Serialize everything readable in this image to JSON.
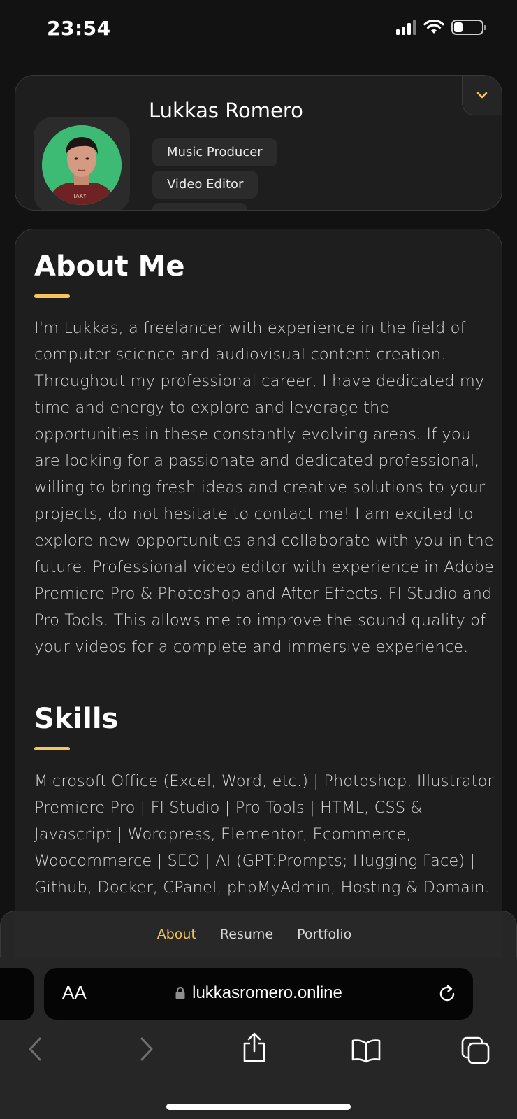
{
  "status_bar": {
    "time": "23:54",
    "battery_level": 0.25
  },
  "profile": {
    "name": "Lukkas Romero",
    "titles": [
      "Music Producer",
      "Video Editor",
      ""
    ]
  },
  "about": {
    "heading": "About Me",
    "text": "I'm Lukkas, a freelancer with experience in the field of computer science and audiovisual content creation. Throughout my professional career, I have dedicated my time and energy to explore and leverage the opportunities in these constantly evolving areas. If you are looking for a passionate and dedicated professional, willing to bring fresh ideas and creative solutions to your projects, do not hesitate to contact me! I am excited to explore new opportunities and collaborate with you in the future. Professional video editor with experience in Adobe Premiere Pro & Photoshop and After Effects. Fl Studio and Pro Tools. This allows me to improve the sound quality of your videos for a complete and immersive experience."
  },
  "skills": {
    "heading": "Skills",
    "text": "Microsoft Office (Excel, Word, etc.) | Photoshop, Illustrator Premiere Pro | Fl Studio | Pro Tools | HTML, CSS & Javascript | Wordpress, Elementor, Ecommerce, Woocommerce | SEO | AI (GPT:Prompts; Hugging Face) | Github, Docker, CPanel, phpMyAdmin, Hosting & Domain."
  },
  "nav": {
    "items": [
      "About",
      "Resume",
      "Portfolio"
    ],
    "active": "About"
  },
  "browser": {
    "text_size_label": "AA",
    "url": "lukkasromero.online"
  },
  "colors": {
    "accent": "#f6c35c",
    "background": "#121212",
    "card": "#1e1e1f",
    "avatar_bg": "#3dba74"
  },
  "icons": {
    "toggle": "chevron-down-icon",
    "lock": "lock-icon",
    "reload": "reload-icon",
    "back": "chevron-left-icon",
    "forward": "chevron-right-icon",
    "share": "share-icon",
    "bookmarks": "book-icon",
    "tabs": "tabs-icon"
  }
}
